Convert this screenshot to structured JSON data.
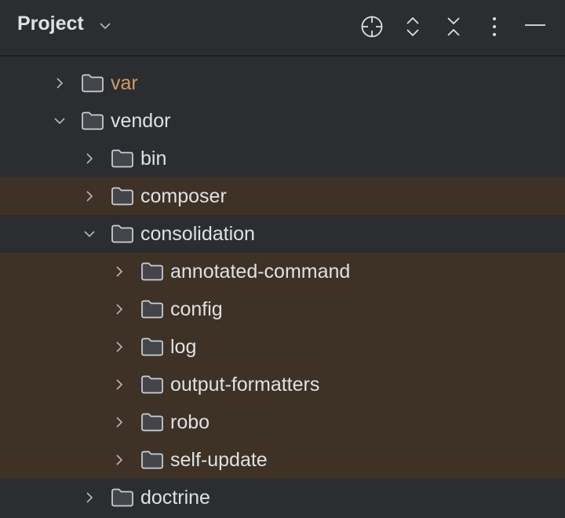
{
  "header": {
    "title": "Project",
    "icons": [
      "chevron-down-icon",
      "locate-icon",
      "expand-all-icon",
      "collapse-all-icon",
      "more-icon",
      "minimize-icon"
    ]
  },
  "colors": {
    "background": "#2b2d30",
    "highlight": "#3d3225",
    "modified_text": "#d49a62",
    "text": "#dfe1e5"
  },
  "tree": [
    {
      "label": "var",
      "level": 1,
      "expanded": false,
      "modified": true,
      "highlighted": false
    },
    {
      "label": "vendor",
      "level": 1,
      "expanded": true,
      "modified": false,
      "highlighted": false
    },
    {
      "label": "bin",
      "level": 2,
      "expanded": false,
      "modified": false,
      "highlighted": false
    },
    {
      "label": "composer",
      "level": 2,
      "expanded": false,
      "modified": false,
      "highlighted": true
    },
    {
      "label": "consolidation",
      "level": 2,
      "expanded": true,
      "modified": false,
      "highlighted": false
    },
    {
      "label": "annotated-command",
      "level": 3,
      "expanded": false,
      "modified": false,
      "highlighted": true
    },
    {
      "label": "config",
      "level": 3,
      "expanded": false,
      "modified": false,
      "highlighted": true
    },
    {
      "label": "log",
      "level": 3,
      "expanded": false,
      "modified": false,
      "highlighted": true
    },
    {
      "label": "output-formatters",
      "level": 3,
      "expanded": false,
      "modified": false,
      "highlighted": true
    },
    {
      "label": "robo",
      "level": 3,
      "expanded": false,
      "modified": false,
      "highlighted": true
    },
    {
      "label": "self-update",
      "level": 3,
      "expanded": false,
      "modified": false,
      "highlighted": true
    },
    {
      "label": "doctrine",
      "level": 2,
      "expanded": false,
      "modified": false,
      "highlighted": false
    }
  ]
}
